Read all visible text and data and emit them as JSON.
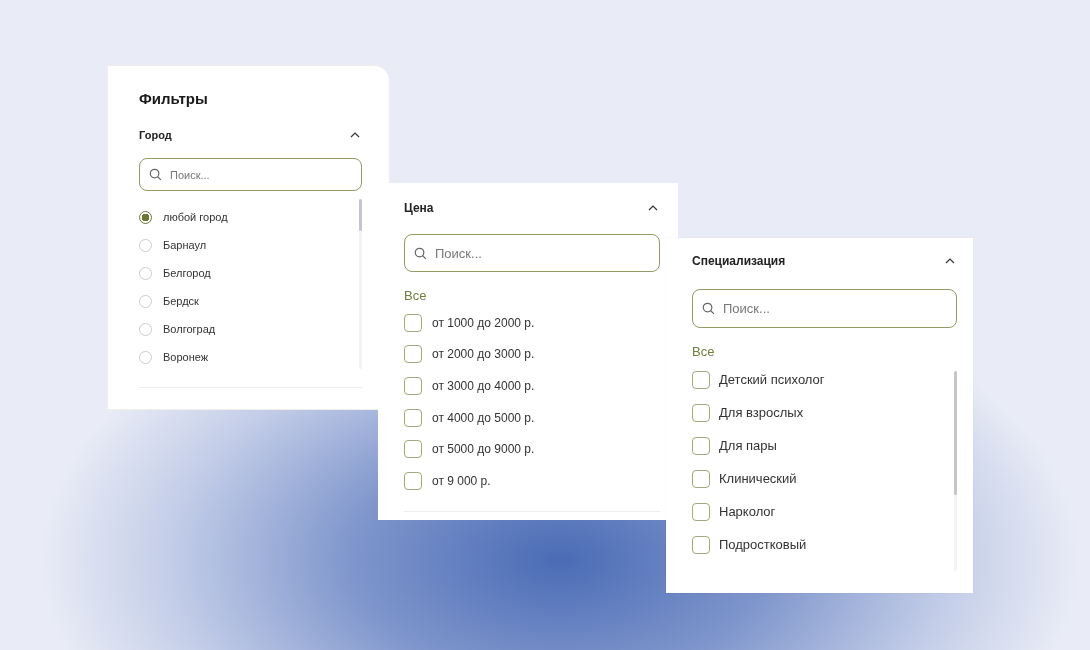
{
  "panels": [
    {
      "heading": "Фильтры",
      "section": {
        "title": "Город",
        "expanded": true
      },
      "search": {
        "placeholder": "Поиск..."
      },
      "kind": "radio",
      "items": [
        {
          "label": "любой город",
          "selected": true
        },
        {
          "label": "Барнаул",
          "selected": false
        },
        {
          "label": "Белгород",
          "selected": false
        },
        {
          "label": "Бердск",
          "selected": false
        },
        {
          "label": "Волгоград",
          "selected": false
        },
        {
          "label": "Воронеж",
          "selected": false
        }
      ]
    },
    {
      "section": {
        "title": "Цена",
        "expanded": true
      },
      "search": {
        "placeholder": "Поиск..."
      },
      "all_label": "Все",
      "kind": "checkbox",
      "items": [
        {
          "label": "от 1000 до 2000 р.",
          "checked": false
        },
        {
          "label": "от 2000 до 3000 р.",
          "checked": false
        },
        {
          "label": "от 3000 до 4000 р.",
          "checked": false
        },
        {
          "label": "от 4000 до 5000 р.",
          "checked": false
        },
        {
          "label": "от 5000 до 9000 р.",
          "checked": false
        },
        {
          "label": "от 9 000 р.",
          "checked": false
        }
      ]
    },
    {
      "section": {
        "title": "Специализация",
        "expanded": true
      },
      "search": {
        "placeholder": "Поиск..."
      },
      "all_label": "Все",
      "kind": "checkbox",
      "items": [
        {
          "label": "Детский психолог",
          "checked": false
        },
        {
          "label": "Для взрослых",
          "checked": false
        },
        {
          "label": "Для пары",
          "checked": false
        },
        {
          "label": "Клинический",
          "checked": false
        },
        {
          "label": "Нарколог",
          "checked": false
        },
        {
          "label": "Подростковый",
          "checked": false
        }
      ]
    }
  ]
}
